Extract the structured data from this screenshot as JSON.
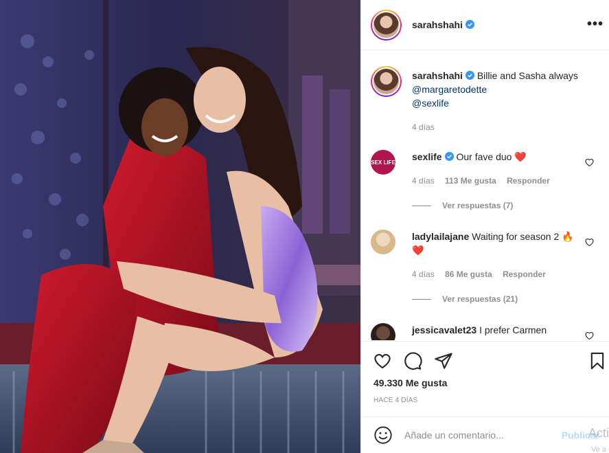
{
  "post": {
    "username": "sarahshahi",
    "caption_text": "Billie and Sasha always",
    "mentions": [
      "@margaretodette",
      "@sexlife"
    ],
    "caption_time": "4 días"
  },
  "comments": [
    {
      "user": "sexlife",
      "text": "Our fave duo ❤️",
      "time": "4 días",
      "likes": "113 Me gusta",
      "reply": "Responder",
      "view_replies": "Ver respuestas (7)",
      "verified": true
    },
    {
      "user": "ladylailajane",
      "text": "Waiting for season 2 🔥❤️",
      "time": "4 días",
      "likes": "86 Me gusta",
      "reply": "Responder",
      "view_replies": "Ver respuestas (21)"
    },
    {
      "user": "jessicavalet23",
      "text": "I prefer Carmen"
    }
  ],
  "stats": {
    "likes": "49.330 Me gusta",
    "date": "HACE 4 DÍAS"
  },
  "composer": {
    "placeholder": "Añade un comentario...",
    "publish": "Publicar"
  },
  "watermark": {
    "line1": "Acti",
    "line2": "Ve a"
  },
  "icons": {
    "more": "more-dots-icon",
    "like": "heart-icon",
    "comment": "comment-icon",
    "share": "send-icon",
    "save": "bookmark-icon",
    "emoji": "emoji-icon",
    "verified": "verified-badge-icon"
  },
  "colors": {
    "verified": "#3897f0",
    "link": "#00376b",
    "muted": "#8e8e8e",
    "heart": "#ed4956"
  }
}
